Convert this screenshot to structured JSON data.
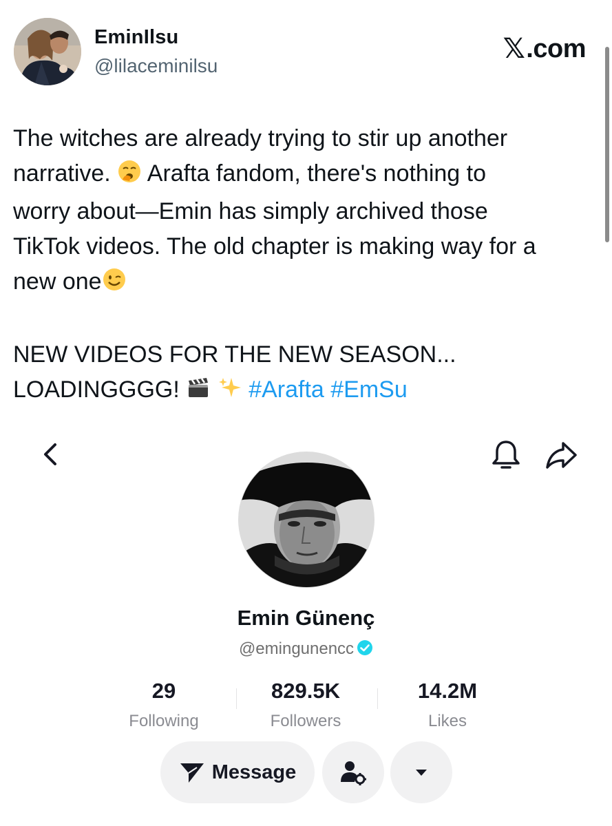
{
  "tweet": {
    "display_name": "EminIlsu",
    "handle": "@lilaceminilsu",
    "source_label": ".com",
    "source_brand_glyph": "𝕏",
    "text_lines": [
      "The witches are already trying to stir up another",
      "narrative.",
      "Arafta fandom, there's nothing to",
      "worry about—Emin has simply archived those",
      "TikTok videos. The old chapter is making way for a",
      "new one"
    ],
    "loading_lines": [
      "NEW VIDEOS FOR THE NEW SEASON...",
      "LOADINGGGG!"
    ],
    "hashtags": [
      "#Arafta",
      "#EmSu"
    ],
    "emojis": [
      "yawning-face",
      "winking-face",
      "clapper-board",
      "sparkles"
    ]
  },
  "tiktok_profile": {
    "name": "Emin Günenç",
    "handle": "@emingunencc",
    "verified": true,
    "stats": [
      {
        "value": "29",
        "label": "Following"
      },
      {
        "value": "829.5K",
        "label": "Followers"
      },
      {
        "value": "14.2M",
        "label": "Likes"
      }
    ],
    "message_button_label": "Message",
    "icons": [
      "back-chevron-icon",
      "bell-icon",
      "share-arrow-icon",
      "send-icon",
      "person-settings-icon",
      "dropdown-caret-icon"
    ]
  },
  "colors": {
    "hashtag": "#1d9bf0",
    "handle_grey": "#536471",
    "verified": "#20d5ec",
    "button_bg": "#f1f1f2"
  }
}
